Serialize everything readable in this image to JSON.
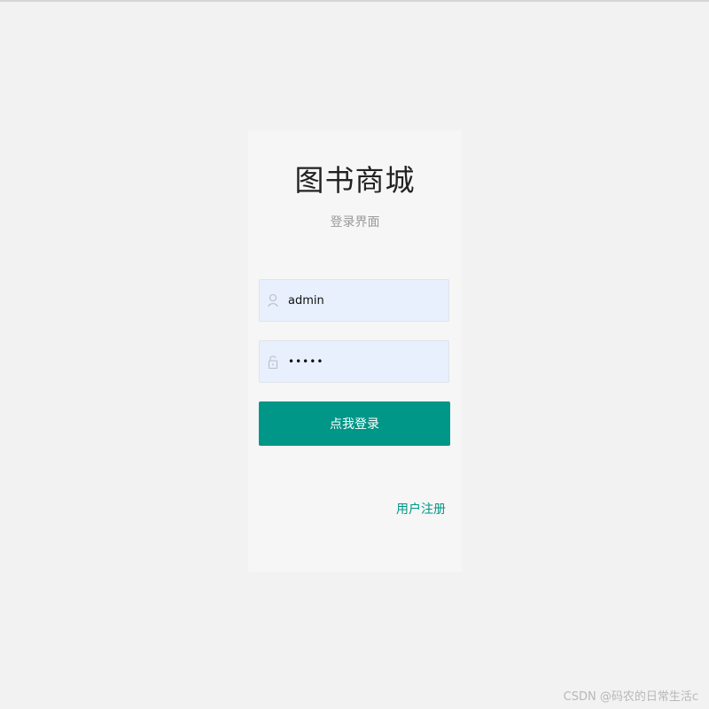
{
  "login": {
    "title": "图书商城",
    "subtitle": "登录界面",
    "username": {
      "value": "admin",
      "icon": "user-icon"
    },
    "password": {
      "value": "•••••",
      "icon": "lock-icon"
    },
    "login_button_label": "点我登录",
    "register_link_label": "用户注册"
  },
  "watermark": "CSDN @码农的日常生活c",
  "colors": {
    "accent": "#009688",
    "input_bg": "#e8f0fe",
    "page_bg": "#f2f2f2",
    "card_bg": "#f6f6f6"
  }
}
